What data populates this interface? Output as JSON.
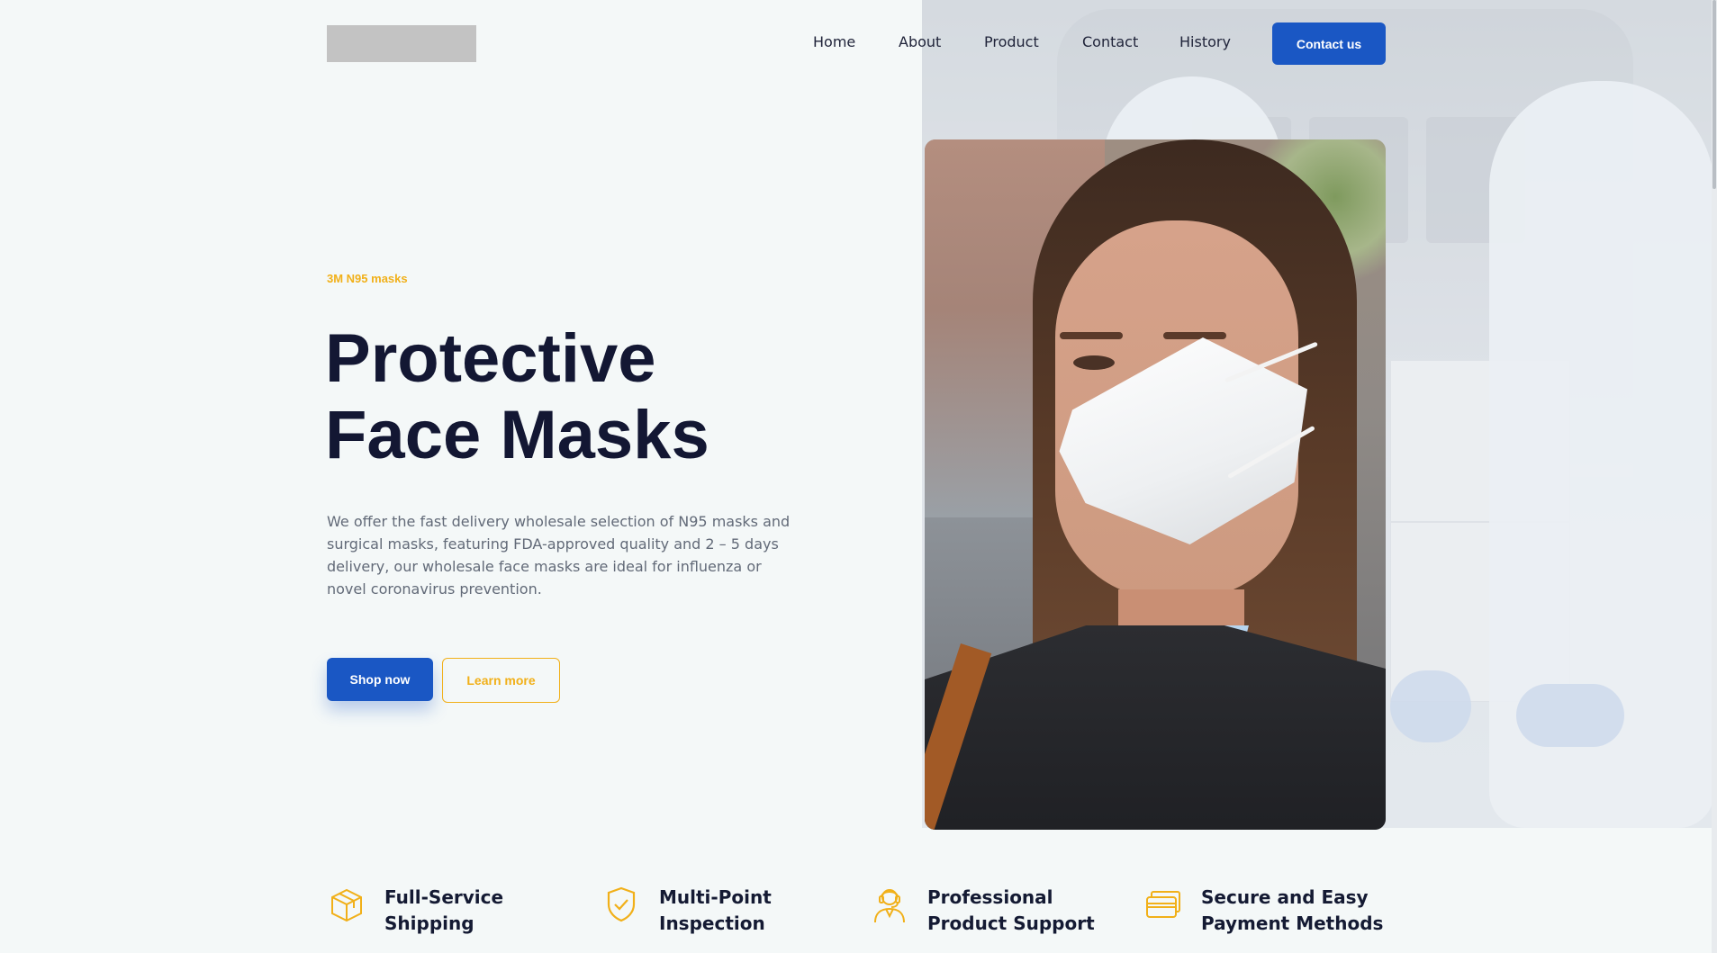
{
  "header": {
    "nav": [
      {
        "label": "Home"
      },
      {
        "label": "About"
      },
      {
        "label": "Product"
      },
      {
        "label": "Contact"
      },
      {
        "label": "History"
      }
    ],
    "contact_button": "Contact us"
  },
  "hero": {
    "eyebrow": "3M N95 masks",
    "title_line1": "Protective",
    "title_line2": "Face Masks",
    "description": "We offer the fast delivery wholesale selection of N95 masks and surgical masks, featuring FDA-approved quality and 2 – 5 days delivery, our wholesale face masks are ideal for influenza or novel coronavirus prevention.",
    "primary_button": "Shop now",
    "secondary_button": "Learn more"
  },
  "features": [
    {
      "icon": "package-icon",
      "line1": "Full-Service",
      "line2": "Shipping"
    },
    {
      "icon": "shield-check-icon",
      "line1": "Multi-Point",
      "line2": "Inspection"
    },
    {
      "icon": "support-agent-icon",
      "line1": "Professional",
      "line2": "Product Support"
    },
    {
      "icon": "credit-card-icon",
      "line1": "Secure and Easy",
      "line2": "Payment Methods"
    }
  ],
  "colors": {
    "accent_blue": "#1a57c4",
    "accent_yellow": "#f1b019",
    "heading": "#131733",
    "body_text": "#626a78",
    "background": "#f4f8f8"
  }
}
